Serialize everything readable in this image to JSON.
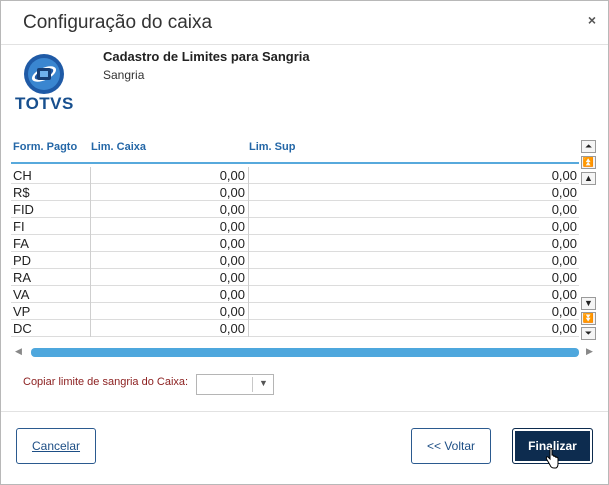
{
  "dialog": {
    "title": "Configuração do caixa",
    "close_glyph": "×"
  },
  "header": {
    "logo_icon": "totvs-logo-icon",
    "logo_text": "TOTVS",
    "title": "Cadastro de Limites para Sangria",
    "subtitle": "Sangria"
  },
  "grid": {
    "columns": [
      "Form. Pagto",
      "Lim. Caixa",
      "Lim. Sup"
    ],
    "rows": [
      [
        "CH",
        "0,00",
        "0,00"
      ],
      [
        "R$",
        "0,00",
        "0,00"
      ],
      [
        "FID",
        "0,00",
        "0,00"
      ],
      [
        "FI",
        "0,00",
        "0,00"
      ],
      [
        "FA",
        "0,00",
        "0,00"
      ],
      [
        "PD",
        "0,00",
        "0,00"
      ],
      [
        "RA",
        "0,00",
        "0,00"
      ],
      [
        "VA",
        "0,00",
        "0,00"
      ],
      [
        "VP",
        "0,00",
        "0,00"
      ],
      [
        "DC",
        "0,00",
        "0,00"
      ]
    ],
    "scroll_glyphs": {
      "first": "⏶",
      "page_up": "⏫",
      "up": "▲",
      "down": "▼",
      "page_down": "⏬",
      "last": "⏷",
      "left": "◀",
      "right": "▶"
    }
  },
  "copy_limit": {
    "label": "Copiar limite de sangria do Caixa:",
    "selected_value": "",
    "arrow_glyph": "▼"
  },
  "footer": {
    "cancel_label": "Cancelar",
    "back_label": "<< Voltar",
    "finish_label": "Finalizar"
  },
  "colors": {
    "header_text": "#2467a7",
    "accent_blue": "#4ea7dd",
    "primary_dark": "#0d2c4f",
    "label_red": "#8b1e1e"
  }
}
